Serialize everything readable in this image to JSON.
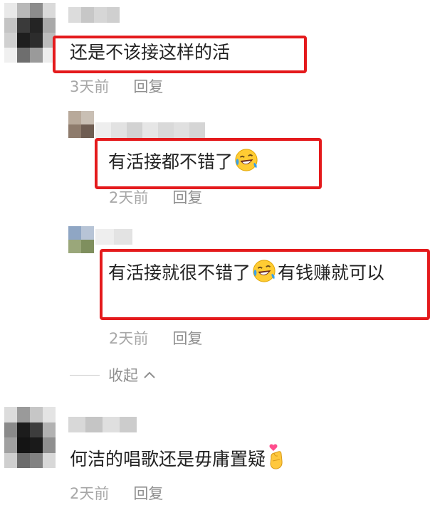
{
  "comments": [
    {
      "text": "还是不该接这样的活",
      "time": "3天前",
      "reply_label": "回复",
      "replies": [
        {
          "text": "有活接都不错了",
          "emoji": "rolling-on-floor-laughing-icon",
          "time": "2天前",
          "reply_label": "回复"
        },
        {
          "text_before": "有活接就很不错了",
          "emoji": "rolling-on-floor-laughing-icon",
          "text_after": "有钱赚就可以",
          "time": "2天前",
          "reply_label": "回复"
        }
      ],
      "collapse_label": "收起"
    },
    {
      "text": "何洁的唱歌还是毋庸置疑",
      "emoji": "finger-heart-icon",
      "time": "2天前",
      "reply_label": "回复"
    }
  ],
  "colors": {
    "highlight": "#e41a1c",
    "meta_text": "#a7a7a7",
    "body_text": "#222222"
  }
}
